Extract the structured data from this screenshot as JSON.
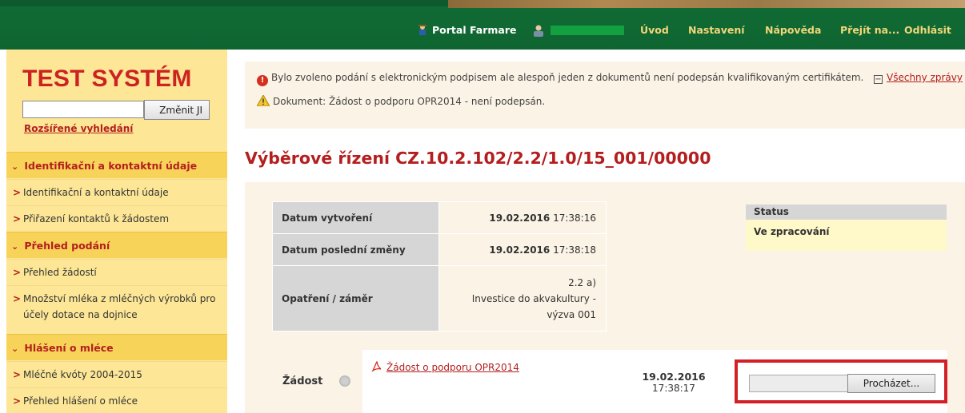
{
  "header": {
    "portal_label": "Portal Farmare",
    "nav": {
      "uvod": "Úvod",
      "nastaveni": "Nastavení",
      "napoveda": "Nápověda",
      "prejit": "Přejít na...",
      "odhlasit": "Odhlásit"
    }
  },
  "sidebar": {
    "title": "TEST SYSTÉM",
    "ji_input_value": "",
    "ji_button": "Změnit JI",
    "advanced_search": "Rozšířené vyhledání",
    "sections": [
      {
        "label": "Identifikační a kontaktní údaje",
        "items": [
          "Identifikační a kontaktní údaje",
          "Přiřazení kontaktů k žádostem"
        ]
      },
      {
        "label": "Přehled podání",
        "items": [
          "Přehled žádostí",
          "Množství mléka z mléčných výrobků pro účely dotace na dojnice"
        ]
      },
      {
        "label": "Hlášení o mléce",
        "items": [
          "Mléčné kvóty 2004-2015",
          "Přehled hlášení o mléce"
        ]
      }
    ]
  },
  "messages": {
    "error": "Bylo zvoleno podání s elektronickým podpisem ale alespoň jeden z dokumentů není podepsán kvalifikovaným certifikátem.",
    "warning": "Dokument: Žádost o podporu OPR2014 - není podepsán.",
    "all_messages": "Všechny zprávy",
    "collapse_symbol": "−"
  },
  "page_title": "Výběrové řízení CZ.10.2.102/2.2/1.0/15_001/00000",
  "info": {
    "created_label": "Datum vytvoření",
    "created_date": "19.02.2016",
    "created_time": "17:38:16",
    "modified_label": "Datum poslední změny",
    "modified_date": "19.02.2016",
    "modified_time": "17:38:18",
    "measure_label": "Opatření / záměr",
    "measure_line1": "2.2 a)",
    "measure_line2": "Investice do akvakultury -",
    "measure_line3": "výzva 001"
  },
  "status": {
    "header": "Status",
    "value": "Ve zpracování"
  },
  "zadost": {
    "label": "Žádost",
    "document_link": "Žádost o podporu OPR2014",
    "date": "19.02.2016",
    "time": "17:38:17",
    "browse_button": "Procházet..."
  },
  "colors": {
    "header_green": "#0f6531",
    "nav_gold": "#f2d77a",
    "sidebar_bg": "#fde796",
    "sidebar_head_bg": "#f8d35a",
    "accent_red": "#b41e1e",
    "highlight_red": "#d32027"
  },
  "icons": [
    "farmer-icon",
    "user-icon",
    "error-icon",
    "warning-icon",
    "collapse-icon",
    "chevron-down-icon",
    "chevron-right-icon",
    "pdf-icon",
    "seal-icon"
  ]
}
